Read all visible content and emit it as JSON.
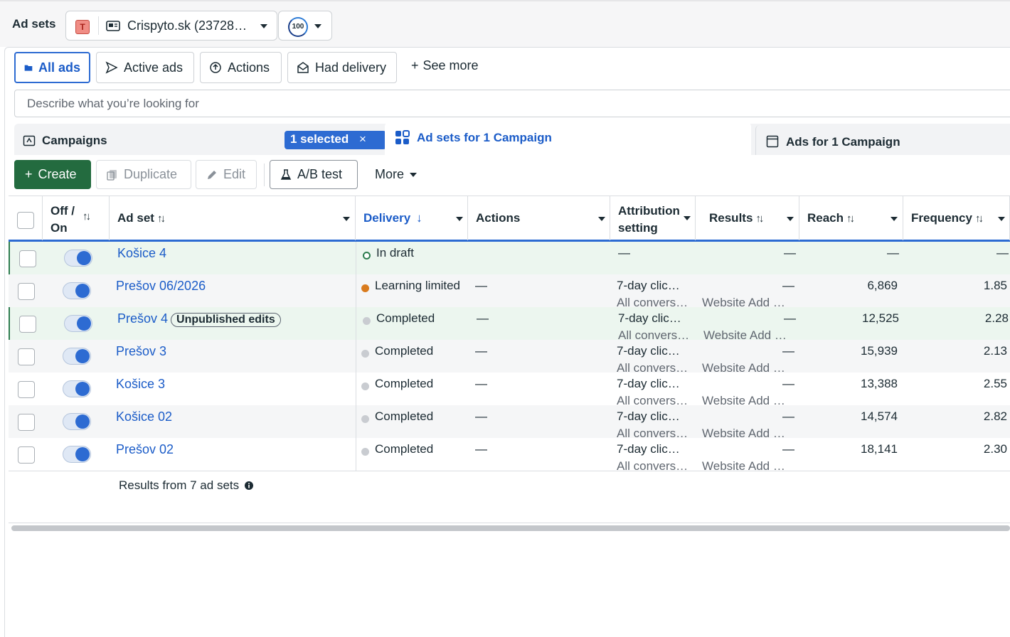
{
  "header": {
    "title": "Ad sets",
    "account_badge": "T",
    "account_label": "Crispyto.sk (23728…",
    "score": "100"
  },
  "filters": {
    "chips": [
      "All ads",
      "Active ads",
      "Actions",
      "Had delivery"
    ],
    "see_more": "See more",
    "search_placeholder": "Describe what you’re looking for"
  },
  "tabs": {
    "campaigns": "Campaigns",
    "selected_badge": "1 selected",
    "adsets": "Ad sets for 1 Campaign",
    "ads": "Ads for 1 Campaign"
  },
  "toolbar": {
    "create": "Create",
    "duplicate": "Duplicate",
    "edit": "Edit",
    "ab_test": "A/B test",
    "more": "More"
  },
  "columns": {
    "off_on": "Off / On",
    "ad_set": "Ad set",
    "delivery": "Delivery",
    "actions": "Actions",
    "attribution": "Attribution setting",
    "results": "Results",
    "reach": "Reach",
    "frequency": "Frequency"
  },
  "rows": [
    {
      "name": "Košice 4",
      "badge": "",
      "delivery": "In draft",
      "actions": "",
      "attr1": "—",
      "attr2": "",
      "results": "—",
      "results2": "",
      "reach": "—",
      "frequency": "—"
    },
    {
      "name": "Prešov 06/2026",
      "badge": "",
      "delivery": "Learning limited",
      "actions": "—",
      "attr1": "7-day clic…",
      "attr2": "All convers…",
      "results": "—",
      "results2": "Website Add …",
      "reach": "6,869",
      "frequency": "1.85"
    },
    {
      "name": "Prešov 4",
      "badge": "Unpublished edits",
      "delivery": "Completed",
      "actions": "—",
      "attr1": "7-day clic…",
      "attr2": "All convers…",
      "results": "—",
      "results2": "Website Add …",
      "reach": "12,525",
      "frequency": "2.28"
    },
    {
      "name": "Prešov 3",
      "badge": "",
      "delivery": "Completed",
      "actions": "—",
      "attr1": "7-day clic…",
      "attr2": "All convers…",
      "results": "—",
      "results2": "Website Add …",
      "reach": "15,939",
      "frequency": "2.13"
    },
    {
      "name": "Košice 3",
      "badge": "",
      "delivery": "Completed",
      "actions": "—",
      "attr1": "7-day clic…",
      "attr2": "All convers…",
      "results": "—",
      "results2": "Website Add …",
      "reach": "13,388",
      "frequency": "2.55"
    },
    {
      "name": "Košice 02",
      "badge": "",
      "delivery": "Completed",
      "actions": "—",
      "attr1": "7-day clic…",
      "attr2": "All convers…",
      "results": "—",
      "results2": "Website Add …",
      "reach": "14,574",
      "frequency": "2.82"
    },
    {
      "name": "Prešov 02",
      "badge": "",
      "delivery": "Completed",
      "actions": "—",
      "attr1": "7-day clic…",
      "attr2": "All convers…",
      "results": "—",
      "results2": "Website Add …",
      "reach": "18,141",
      "frequency": "2.30"
    }
  ],
  "footer": {
    "summary": "Results from 7 ad sets"
  },
  "colors": {
    "accent": "#2d6bd2",
    "create": "#236b3f",
    "draft_dot": "#2e7d4f",
    "learning_dot": "#d97b1e",
    "completed_dot": "#c9ccd1"
  }
}
